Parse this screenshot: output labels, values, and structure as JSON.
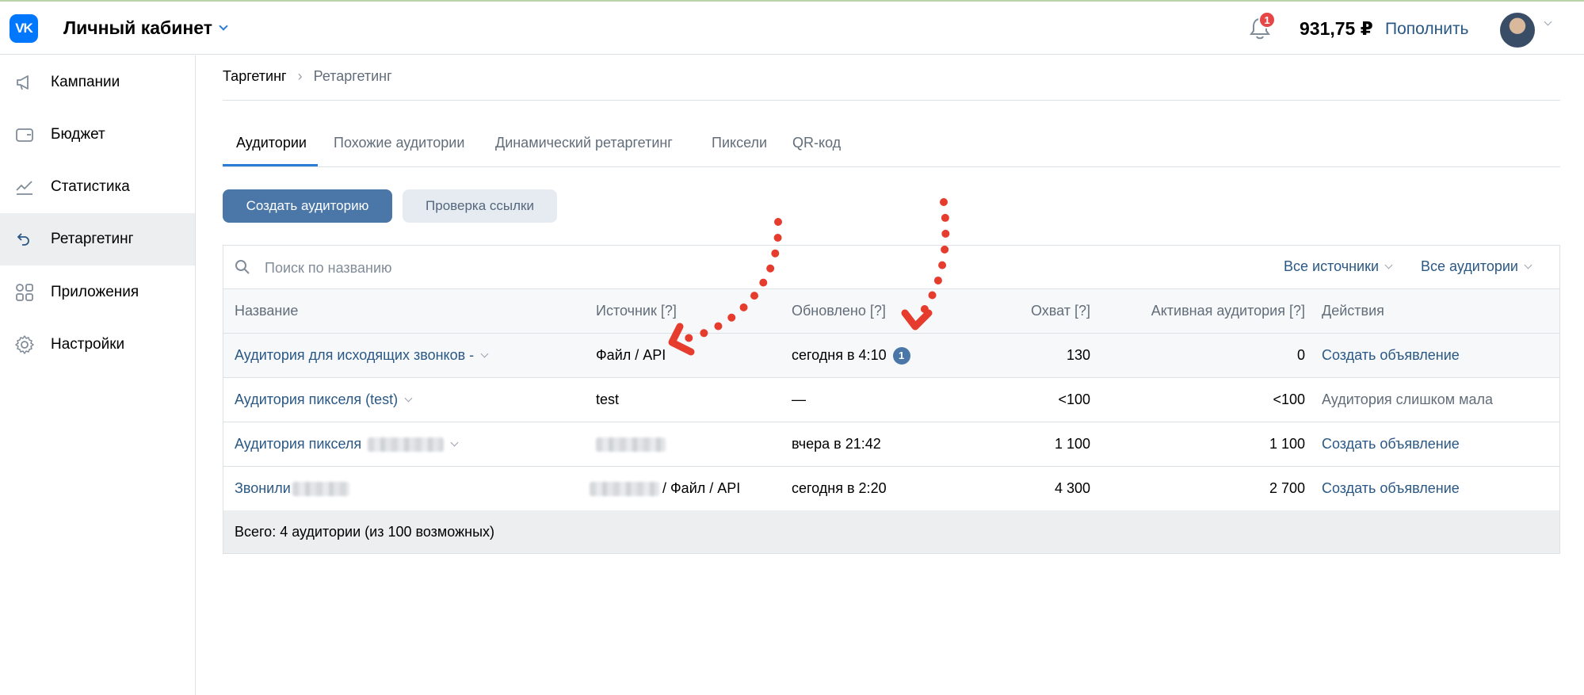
{
  "header": {
    "logo_text": "VK",
    "cabinet_title": "Личный кабинет",
    "notification_count": "1",
    "balance": "931,75 ₽",
    "topup_label": "Пополнить"
  },
  "sidebar": {
    "items": [
      {
        "label": "Кампании",
        "icon": "megaphone-icon"
      },
      {
        "label": "Бюджет",
        "icon": "wallet-icon"
      },
      {
        "label": "Статистика",
        "icon": "chart-line-icon"
      },
      {
        "label": "Ретаргетинг",
        "icon": "retarget-arrow-icon",
        "active": true
      },
      {
        "label": "Приложения",
        "icon": "apps-grid-icon"
      },
      {
        "label": "Настройки",
        "icon": "gear-icon"
      }
    ]
  },
  "breadcrumb": {
    "first": "Таргетинг",
    "second": "Ретаргетинг"
  },
  "tabs": [
    {
      "label": "Аудитории",
      "active": true
    },
    {
      "label": "Похожие аудитории"
    },
    {
      "label": "Динамический ретаргетинг"
    },
    {
      "label": "Пиксели"
    },
    {
      "label": "QR-код"
    }
  ],
  "actions": {
    "create_audience": "Создать аудиторию",
    "check_link": "Проверка ссылки"
  },
  "table": {
    "search_placeholder": "Поиск по названию",
    "filter_sources": "Все источники",
    "filter_audiences": "Все аудитории",
    "columns": {
      "name": "Название",
      "source": "Источник [?]",
      "updated": "Обновлено [?]",
      "reach": "Охват [?]",
      "active": "Активная аудитория [?]",
      "actions": "Действия"
    },
    "rows": [
      {
        "name": "Аудитория для исходящих звонков -",
        "source": "Файл / API",
        "updated": "сегодня в 4:10",
        "updated_badge": "1",
        "reach": "130",
        "active": "0",
        "action": "Создать объявление"
      },
      {
        "name": "Аудитория пикселя (test)",
        "source": "test",
        "updated": "—",
        "reach": "<100",
        "active": "<100",
        "action": "Аудитория слишком мала"
      },
      {
        "name": "Аудитория пикселя",
        "source": "",
        "updated": "вчера в 21:42",
        "reach": "1 100",
        "active": "1 100",
        "action": "Создать объявление"
      },
      {
        "name": "Звонили",
        "source": "/ Файл / API",
        "updated": "сегодня в 2:20",
        "reach": "4 300",
        "active": "2 700",
        "action": "Создать объявление"
      }
    ],
    "footer": "Всего: 4 аудитории (из 100 возможных)"
  },
  "colors": {
    "accent_blue": "#4a76a8",
    "link": "#2a5885",
    "badge_red": "#e64646",
    "annotation_red": "#e63c2e"
  }
}
